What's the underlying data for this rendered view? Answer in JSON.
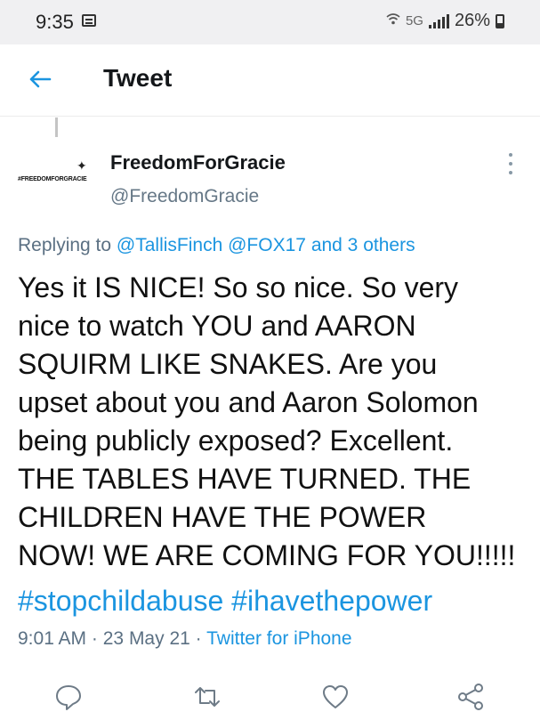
{
  "status_bar": {
    "time": "9:35",
    "network": "5G",
    "battery": "26%"
  },
  "header": {
    "title": "Tweet",
    "back_icon": "back-arrow-icon"
  },
  "tweet": {
    "avatar_text": "#FREEDOMFORGRACIE",
    "display_name": "FreedomForGracie",
    "handle": "@FreedomGracie",
    "replying_prefix": "Replying to",
    "replying_mentions": [
      "@TallisFinch",
      "@FOX17"
    ],
    "replying_others": "and 3 others",
    "body_lines": [
      "Yes it IS NICE! So so nice. So very",
      "nice to watch YOU and AARON",
      "SQUIRM LIKE SNAKES. Are you",
      "upset about you and Aaron Solomon",
      "being publicly exposed? Excellent.",
      "THE TABLES HAVE TURNED. THE",
      "CHILDREN HAVE THE POWER",
      "NOW! WE ARE COMING FOR YOU!!!!!"
    ],
    "hashtags": [
      "#stopchildabuse",
      "#ihavethepower"
    ],
    "time": "9:01 AM",
    "date": "23 May 21",
    "separator": "·",
    "source": "Twitter for iPhone"
  },
  "actions": [
    "reply-icon",
    "retweet-icon",
    "like-icon",
    "share-icon"
  ],
  "colors": {
    "accent": "#1b95e0",
    "secondary_text": "#5b7083",
    "icon_gray": "#6e7b87"
  }
}
